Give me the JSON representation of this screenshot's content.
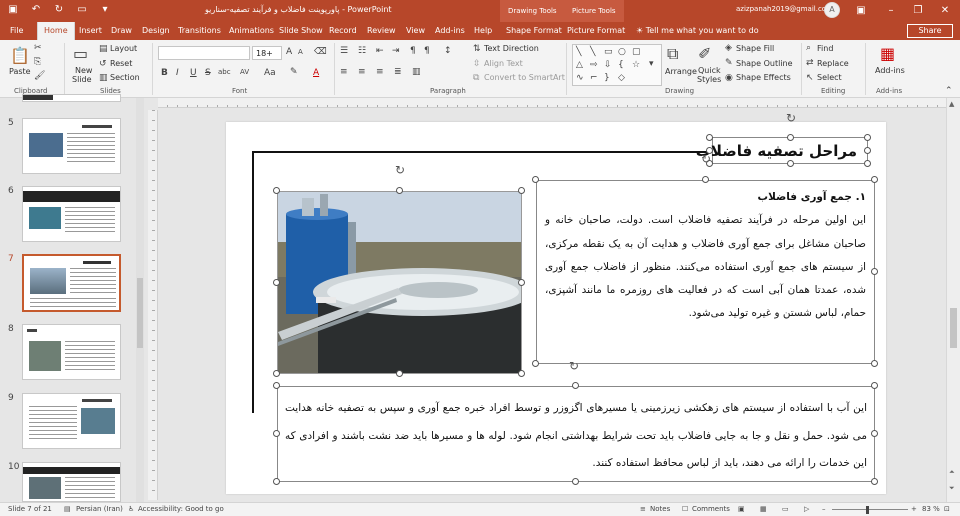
{
  "titlebar": {
    "document_title": "پاورپوینت فاضلاب و فرآیند تصفیه-سناریو  -  PowerPoint",
    "context_drawing": "Drawing Tools",
    "context_picture": "Picture Tools",
    "account": "azizpanah2019@gmail.com",
    "avatar": "A"
  },
  "tabs": [
    "File",
    "Home",
    "Insert",
    "Draw",
    "Design",
    "Transitions",
    "Animations",
    "Slide Show",
    "Record",
    "Review",
    "View",
    "Add-ins",
    "Help",
    "Shape Format",
    "Picture Format"
  ],
  "active_tab": "Home",
  "tell_me": "Tell me what you want to do",
  "share": "Share",
  "ribbon": {
    "clipboard": {
      "label": "Clipboard",
      "paste": "Paste"
    },
    "slides": {
      "label": "Slides",
      "new_slide": "New",
      "new_slide2": "Slide",
      "layout": "Layout",
      "reset": "Reset",
      "section": "Section"
    },
    "font": {
      "label": "Font",
      "size": "18+",
      "bold": "B",
      "italic": "I",
      "underline": "U",
      "strike": "S",
      "shadow": "abc",
      "spacing": "AV",
      "case": "Aa",
      "color": "A",
      "grow": "A",
      "shrink": "A"
    },
    "paragraph": {
      "label": "Paragraph",
      "text_direction": "Text Direction",
      "align_text": "Align Text",
      "smartart": "Convert to SmartArt"
    },
    "drawing": {
      "label": "Drawing",
      "arrange": "Arrange",
      "quick_styles": "Quick",
      "quick_styles2": "Styles",
      "shape_fill": "Shape Fill",
      "shape_outline": "Shape Outline",
      "shape_effects": "Shape Effects"
    },
    "editing": {
      "label": "Editing",
      "find": "Find",
      "replace": "Replace",
      "select": "Select"
    },
    "addins": {
      "label": "Add-ins",
      "addins": "Add-ins"
    }
  },
  "thumbnails": [
    {
      "num": "5",
      "selected": false
    },
    {
      "num": "6",
      "selected": false
    },
    {
      "num": "7",
      "selected": true
    },
    {
      "num": "8",
      "selected": false
    },
    {
      "num": "9",
      "selected": false
    },
    {
      "num": "10",
      "selected": false
    }
  ],
  "slide": {
    "heading": "مراحل تصفیه فاضلاب",
    "box1_heading": "۱. جمع آوری فاضلاب",
    "box1_body": "این اولین مرحله در فرآیند تصفیه فاضلاب است. دولت، صاحبان خانه و صاحبان مشاغل برای جمع آوری فاضلاب و هدایت آن به یک نقطه مرکزی، از سیستم های جمع آوری استفاده می‌کنند. منظور از فاضلاب جمع آوری شده، عمدتا همان آبی است که در فعالیت های روزمره ما مانند آشپزی، حمام، لباس شستن و غیره تولید می‌شود.",
    "box2_body": "این آب با استفاده از سیستم های زهکشی زیرزمینی یا مسیرهای اگزوزر و توسط افراد خبره جمع آوری و سپس به تصفیه خانه هدایت می شود. حمل و نقل و جا به جایی فاضلاب باید تحت شرایط بهداشتی انجام شود. لوله ها و مسیرها باید ضد نشت باشند و افرادی که این خدمات را ارائه می دهند، باید از لباس محافظ استفاده کنند."
  },
  "status": {
    "slide_of": "Slide 7 of 21",
    "language": "Persian (Iran)",
    "accessibility": "Accessibility: Good to go",
    "notes": "Notes",
    "comments": "Comments",
    "zoom": "83 %"
  },
  "colors": {
    "accent": "#b7472a",
    "ribbon_bg": "#f3f3f3",
    "selected_thumb": "#c55a2d"
  }
}
